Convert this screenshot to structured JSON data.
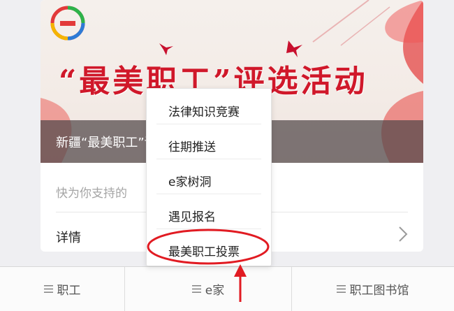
{
  "banner": {
    "headline": "“最美职工”评选活动",
    "overlay_title": "新疆“最美职工”评选活动开始啦！",
    "logo_name": "e-home-logo"
  },
  "card": {
    "description": "快为你支持的",
    "details_label": "详情"
  },
  "popup_menu": {
    "items": [
      {
        "label": "法律知识竞赛"
      },
      {
        "label": "往期推送"
      },
      {
        "label": "e家树洞"
      },
      {
        "label": "遇见报名"
      },
      {
        "label": "最美职工投票"
      }
    ],
    "highlighted_index": 4
  },
  "tabbar": {
    "tabs": [
      {
        "label": "职工"
      },
      {
        "label": "e家"
      },
      {
        "label": "职工图书馆"
      }
    ]
  },
  "colors": {
    "headline_red": "#d0182a",
    "annotation_red": "#e11b22",
    "overlay": "#504648",
    "background": "#efeff2"
  }
}
